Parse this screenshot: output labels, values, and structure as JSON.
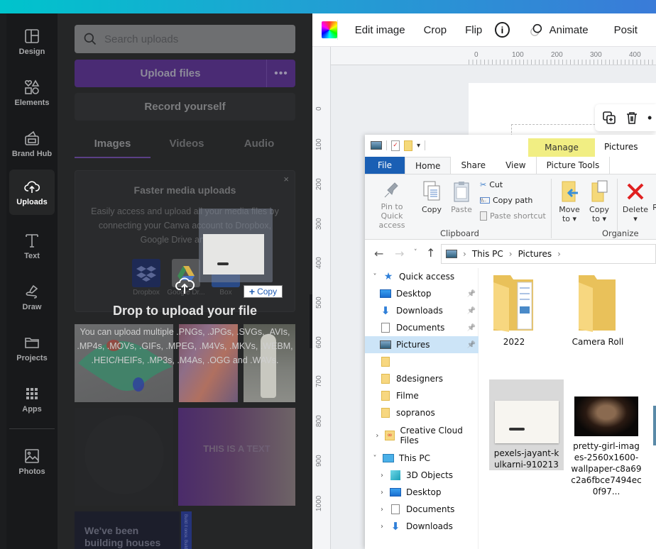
{
  "colors": {
    "brand_gradient_start": "#00c4cc",
    "brand_gradient_end": "#3a7bd8",
    "upload_purple": "#4a2b74",
    "explorer_file_blue": "#1a5fb4",
    "manage_yellow": "#f1ee83",
    "selection_blue": "#cce4f7"
  },
  "rail": {
    "items": [
      {
        "label": "Design",
        "icon": "design-icon"
      },
      {
        "label": "Elements",
        "icon": "elements-icon"
      },
      {
        "label": "Brand Hub",
        "icon": "brand-hub-icon"
      },
      {
        "label": "Uploads",
        "icon": "cloud-upload-icon",
        "active": true
      },
      {
        "label": "Text",
        "icon": "text-icon"
      },
      {
        "label": "Draw",
        "icon": "draw-icon"
      },
      {
        "label": "Projects",
        "icon": "folder-icon"
      },
      {
        "label": "Apps",
        "icon": "apps-grid-icon"
      },
      {
        "label": "Photos",
        "icon": "photos-icon"
      }
    ]
  },
  "panel": {
    "search_placeholder": "Search uploads",
    "upload_label": "Upload files",
    "more_label": "•••",
    "record_label": "Record yourself",
    "tabs": [
      {
        "label": "Images",
        "active": true
      },
      {
        "label": "Videos"
      },
      {
        "label": "Audio"
      }
    ],
    "promo": {
      "close": "×",
      "title": "Faster media uploads",
      "text": "Easily access and upload all your media files by connecting your Canva account to Dropbox, Google Drive and Box.",
      "services": [
        {
          "label": "Dropbox",
          "icon": "dropbox-icon"
        },
        {
          "label": "Google Dr...",
          "icon": "google-drive-icon"
        },
        {
          "label": "Box",
          "icon": "box-icon"
        }
      ]
    },
    "drop_title": "Drop to upload your file",
    "drop_text": "You can upload multiple .PNGs, .JPGs, .SVGs, .AVIs, .MP4s, .MOVs, .GIFs, .MPEG, .M4Vs, .MKVs, .WEBM, .HEIC/HEIFs, .MP3s, .M4As, .OGG and .WAVs.",
    "copy_tooltip": "Copy",
    "thumbs": {
      "text_card": "THIS IS A TEXT",
      "houses_card": "We've been building houses",
      "houses_side": "Build it once. Build"
    },
    "collapse": "‹"
  },
  "toolbar": {
    "edit_image": "Edit image",
    "crop": "Crop",
    "flip": "Flip",
    "info": "i",
    "animate": "Animate",
    "position": "Posit"
  },
  "ruler": {
    "h": [
      "0",
      "100",
      "200",
      "300",
      "400"
    ],
    "v": [
      "0",
      "100",
      "200",
      "300",
      "400",
      "500",
      "600",
      "700",
      "800",
      "900",
      "1000"
    ]
  },
  "explorer": {
    "manage": "Manage",
    "title": "Pictures",
    "tabs": [
      "File",
      "Home",
      "Share",
      "View",
      "Picture Tools"
    ],
    "ribbon": {
      "pin": "Pin to Quick access",
      "copy": "Copy",
      "paste": "Paste",
      "cut": "Cut",
      "copy_path": "Copy path",
      "paste_shortcut": "Paste shortcut",
      "clipboard": "Clipboard",
      "move_to": "Move to ▾",
      "copy_to": "Copy to ▾",
      "delete": "Delete",
      "rename": "R",
      "organize": "Organize"
    },
    "address": [
      "This PC",
      "Pictures"
    ],
    "nav": [
      {
        "label": "Quick access",
        "expand": "˅",
        "icon": "star"
      },
      {
        "label": "Desktop",
        "pinned": true,
        "icon": "desktop"
      },
      {
        "label": "Downloads",
        "pinned": true,
        "icon": "download"
      },
      {
        "label": "Documents",
        "pinned": true,
        "icon": "document"
      },
      {
        "label": "Pictures",
        "pinned": true,
        "icon": "pictures",
        "selected": true
      },
      {
        "label": "",
        "icon": "folder"
      },
      {
        "label": "8designers",
        "icon": "folder"
      },
      {
        "label": "Filme",
        "icon": "folder"
      },
      {
        "label": "sopranos",
        "icon": "folder"
      },
      {
        "label": "Creative Cloud Files",
        "expand": "›",
        "icon": "cc"
      },
      {
        "label": "This PC",
        "expand": "˅",
        "icon": "pc"
      },
      {
        "label": "3D Objects",
        "expand": "›",
        "icon": "3d"
      },
      {
        "label": "Desktop",
        "expand": "›",
        "icon": "desktop"
      },
      {
        "label": "Documents",
        "expand": "›",
        "icon": "document"
      },
      {
        "label": "Downloads",
        "expand": "›",
        "icon": "download"
      }
    ],
    "files": [
      {
        "name": "2022",
        "type": "folder-with-files"
      },
      {
        "name": "Camera Roll",
        "type": "folder"
      },
      {
        "name": "pexels-jayant-kulkarni-910213",
        "type": "image",
        "selected": true
      },
      {
        "name": "pretty-girl-images-2560x1600-wallpaper-c8a69c2a6fbce7494ec0f97...",
        "type": "image"
      }
    ]
  }
}
